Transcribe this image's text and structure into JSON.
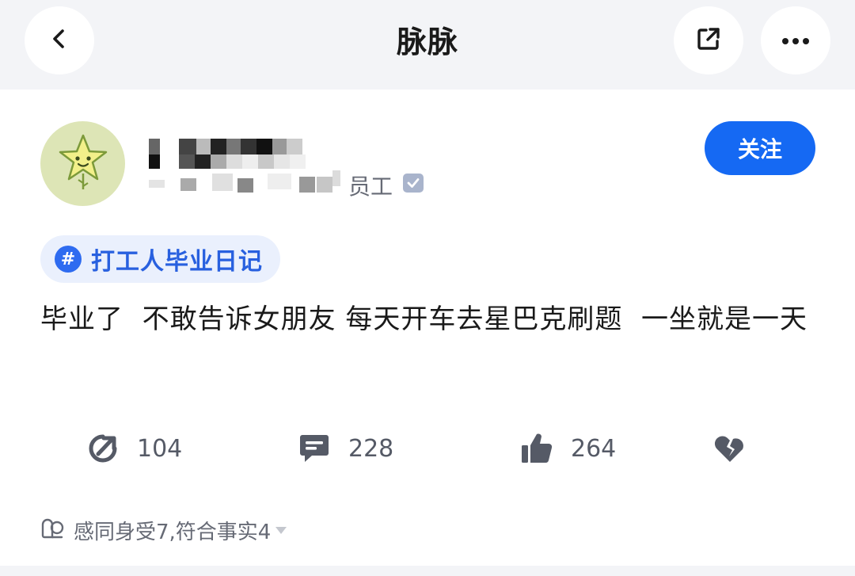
{
  "nav": {
    "title": "脉脉",
    "back_icon": "chevron-left-icon",
    "share_icon": "share-external-icon",
    "more_icon": "more-dots-icon"
  },
  "author": {
    "company_suffix": "员工",
    "verified_icon": "verified-check-icon",
    "avatar_icon": "star-avatar-icon"
  },
  "follow_button": {
    "label": "关注"
  },
  "topic": {
    "label": "打工人毕业日记",
    "icon": "hash-icon"
  },
  "post": {
    "text": "毕业了  不敢告诉女朋友 每天开车去星巴克刷题  一坐就是一天"
  },
  "actions": {
    "forward": {
      "count": "104",
      "icon": "forward-arrow-icon"
    },
    "comment": {
      "count": "228",
      "icon": "comment-bubble-icon"
    },
    "like": {
      "count": "264",
      "icon": "thumbs-up-icon"
    },
    "dislike": {
      "icon": "broken-heart-icon"
    }
  },
  "reactions": {
    "text": "感同身受7,符合事实4",
    "icon": "reaction-face-icon"
  },
  "colors": {
    "accent": "#1569f3",
    "topbar_bg": "#f3f4f7",
    "tag_bg": "#eaf0fd",
    "tag_text": "#2860df",
    "avatar_bg": "#dde5b6"
  }
}
